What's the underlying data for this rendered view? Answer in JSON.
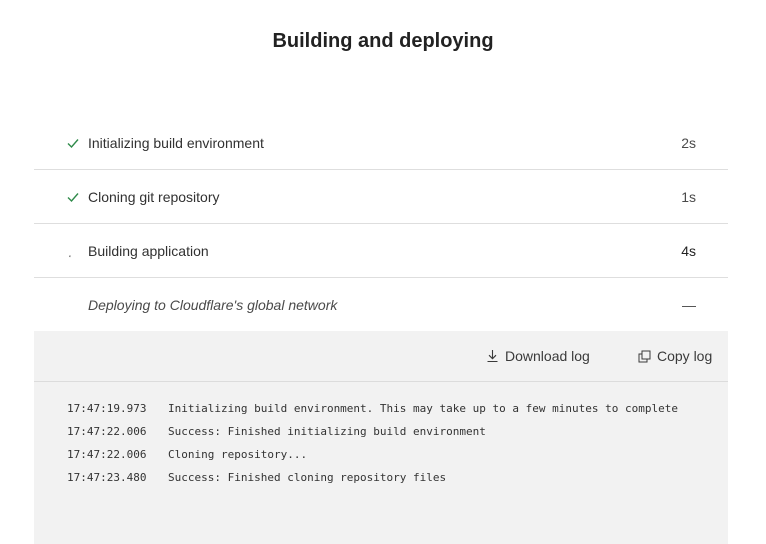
{
  "page": {
    "title": "Building and deploying"
  },
  "steps": [
    {
      "label": "Initializing build environment",
      "duration": "2s",
      "status": "done",
      "icon": "check-icon"
    },
    {
      "label": "Cloning git repository",
      "duration": "1s",
      "status": "done",
      "icon": "check-icon"
    },
    {
      "label": "Building application",
      "duration": "4s",
      "status": "in-progress",
      "icon": "spinner-icon"
    },
    {
      "label": "Deploying to Cloudflare's global network",
      "duration": "—",
      "status": "pending",
      "icon": ""
    }
  ],
  "log": {
    "download_label": "Download log",
    "copy_label": "Copy log",
    "lines": [
      {
        "time": "17:47:19.973",
        "message": "Initializing build environment. This may take up to a few minutes to complete"
      },
      {
        "time": "17:47:22.006",
        "message": "Success: Finished initializing build environment"
      },
      {
        "time": "17:47:22.006",
        "message": "Cloning repository..."
      },
      {
        "time": "17:47:23.480",
        "message": "Success: Finished cloning repository files"
      }
    ]
  },
  "colors": {
    "success": "#2f8a4a",
    "panel_bg": "#f2f2f2",
    "divider": "#dedede"
  }
}
